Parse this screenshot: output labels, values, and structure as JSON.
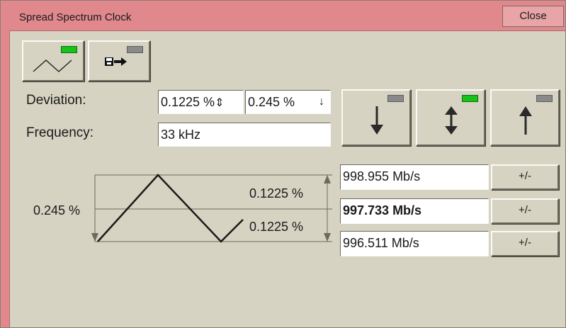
{
  "window": {
    "title": "Spread Spectrum Clock",
    "close_label": "Close"
  },
  "toolbar": {
    "waveform_button": {
      "icon": "triangle-wave-icon",
      "indicator": "on"
    },
    "save_button": {
      "icon": "save-to-disk-icon",
      "indicator": "off"
    }
  },
  "deviation": {
    "label": "Deviation:",
    "center_value": "0.1225 %",
    "center_arrow": "⇕",
    "down_value": "0.245 %",
    "down_arrow": "↓"
  },
  "frequency": {
    "label": "Frequency:",
    "value": "33 kHz"
  },
  "mode_buttons": [
    {
      "name": "down-spread",
      "icon": "arrow-down-icon",
      "indicator": "off"
    },
    {
      "name": "center-spread",
      "icon": "arrow-updown-icon",
      "indicator": "on"
    },
    {
      "name": "up-spread",
      "icon": "arrow-up-icon",
      "indicator": "off"
    }
  ],
  "diagram": {
    "left_label": "0.245 %",
    "upper_right_label": "0.1225 %",
    "lower_right_label": "0.1225 %"
  },
  "rates": [
    {
      "value": "998.955 Mb/s",
      "button": "+/-",
      "bold": false
    },
    {
      "value": "997.733 Mb/s",
      "button": "+/-",
      "bold": true
    },
    {
      "value": "996.511 Mb/s",
      "button": "+/-",
      "bold": false
    }
  ],
  "colors": {
    "title_bar": "#e0888c",
    "panel": "#d6d3c2",
    "led_on": "#19c21b",
    "led_off": "#8a8a8a"
  }
}
